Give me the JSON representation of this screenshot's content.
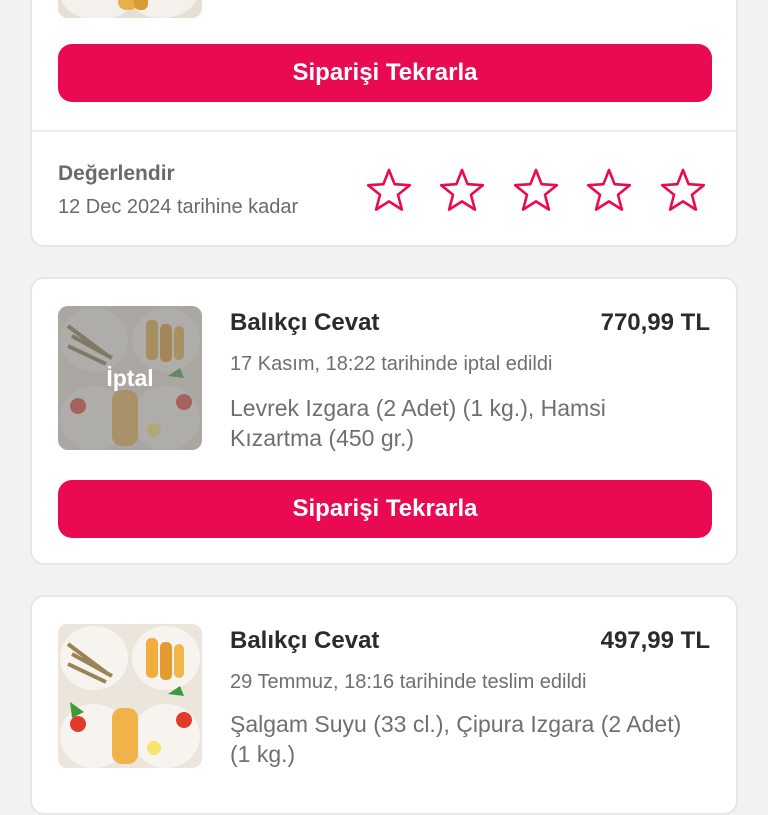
{
  "orders": [
    {
      "repeat_label": "Siparişi Tekrarla",
      "rating": {
        "title": "Değerlendir",
        "deadline": "12 Dec 2024 tarihine kadar",
        "stars": 5
      }
    },
    {
      "restaurant": "Balıkçı Cevat",
      "price": "770,99 TL",
      "status_text": "17 Kasım, 18:22 tarihinde iptal edildi",
      "items": "Levrek Izgara (2 Adet) (1 kg.), Hamsi Kızartma (450 gr.)",
      "badge": "İptal",
      "repeat_label": "Siparişi Tekrarla"
    },
    {
      "restaurant": "Balıkçı Cevat",
      "price": "497,99 TL",
      "status_text": "29 Temmuz, 18:16 tarihinde teslim edildi",
      "items": "Şalgam Suyu (33 cl.), Çipura Izgara (2 Adet) (1 kg.)"
    }
  ],
  "colors": {
    "accent": "#ea0a52",
    "card": "#ffffff",
    "background": "#f2f2f2"
  },
  "icons": {
    "star": "star-outline-icon",
    "food": "fish-platter-image"
  }
}
